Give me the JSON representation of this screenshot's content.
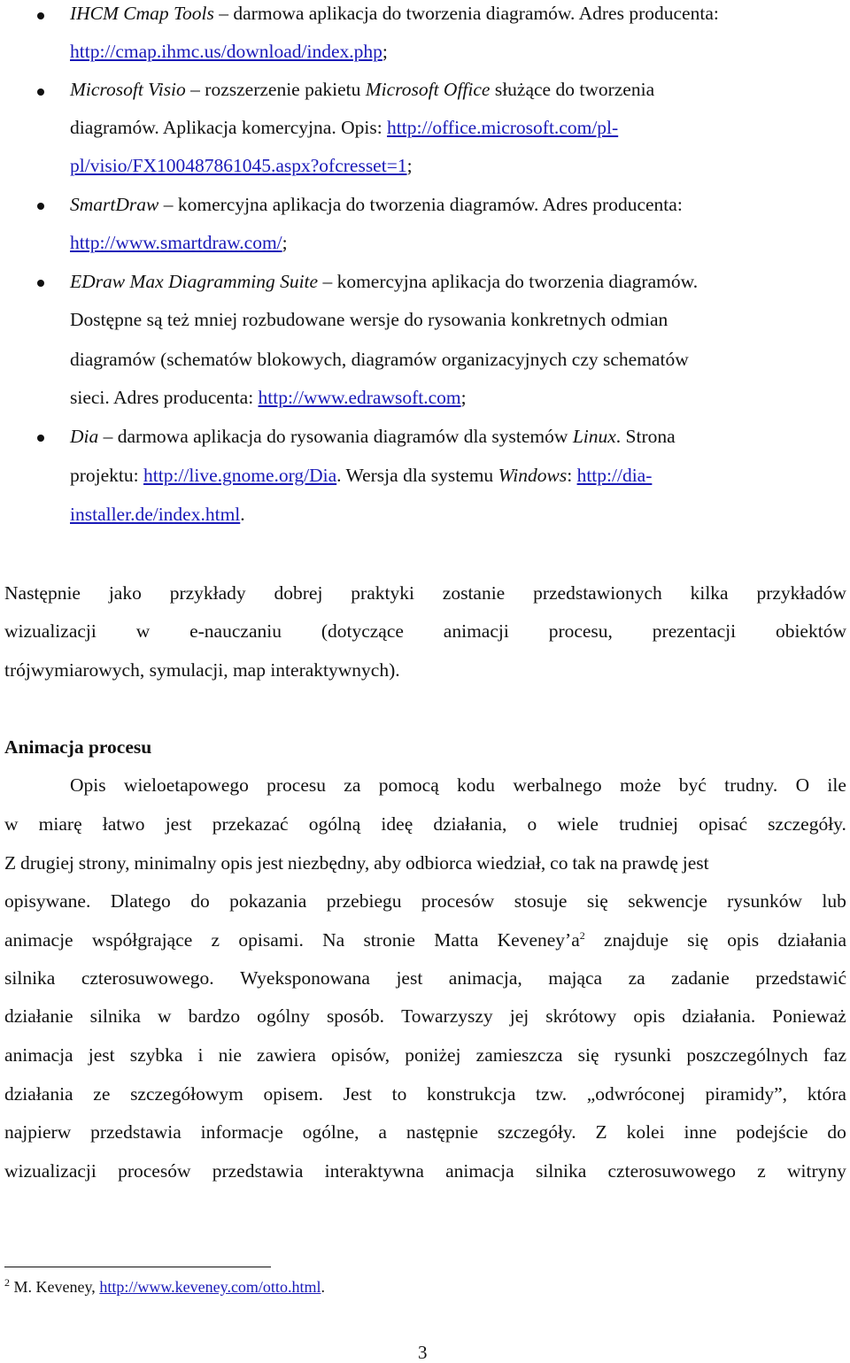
{
  "bullets": [
    {
      "name_italic": "IHCM Cmap Tools",
      "line1_rest": " – darmowa aplikacja do tworzenia diagramów. Adres producenta:",
      "link1": "http://cmap.ihmc.us/download/index.php",
      "line2_after": ";"
    },
    {
      "name_italic": "Microsoft Visio",
      "line1_mid": " – rozszerzenie pakietu ",
      "line1_italic2": "Microsoft Office",
      "line1_rest": " służące do tworzenia",
      "line2_text": "diagramów. Aplikacja komercyjna. Opis: ",
      "link_part1": "http://office.microsoft.com/pl-",
      "link_part2": "pl/visio/FX100487861045.aspx?ofcresset=1",
      "line3_after": ";"
    },
    {
      "name_italic": "SmartDraw",
      "line1_rest": " – komercyjna aplikacja do tworzenia diagramów. Adres producenta:",
      "link1": "http://www.smartdraw.com/",
      "line2_after": ";"
    },
    {
      "name_italic": "EDraw Max Diagramming Suite",
      "line1_rest": " – komercyjna aplikacja do tworzenia diagramów.",
      "line2_text": "Dostępne są też mniej rozbudowane wersje do rysowania konkretnych odmian",
      "line3_text": "diagramów (schematów blokowych, diagramów organizacyjnych czy schematów",
      "line4_text": "sieci. Adres producenta: ",
      "link1": "http://www.edrawsoft.com",
      "line4_after": ";"
    },
    {
      "name_italic": "Dia",
      "line1_mid": " – darmowa aplikacja do rysowania diagramów dla systemów ",
      "line1_italic2": "Linux",
      "line1_rest": ". Strona",
      "line2_text": "projektu: ",
      "link1": "http://live.gnome.org/Dia",
      "line2_mid": ". Wersja dla systemu ",
      "line2_italic": "Windows",
      "line2_mid2": ": ",
      "link2_part1": "http://dia-",
      "link2_part2": "installer.de/index.html",
      "line3_after": "."
    }
  ],
  "intro_paragraph": {
    "line1": "Następnie jako przykłady dobrej praktyki zostanie przedstawionych kilka przykładów",
    "line2": "wizualizacji w e-nauczaniu (dotyczące animacji procesu, prezentacji obiektów",
    "line3": "trójwymiarowych, symulacji, map interaktywnych)."
  },
  "section": {
    "heading": "Animacja procesu",
    "lines": [
      "Opis wieloetapowego procesu za pomocą kodu werbalnego może być trudny. O ile",
      "w miarę łatwo jest przekazać ogólną ideę działania, o wiele trudniej opisać szczegóły.",
      "Z drugiej strony, minimalny opis jest niezbędny, aby odbiorca wiedział, co tak na prawdę jest",
      "opisywane. Dlatego do pokazania przebiegu procesów stosuje się sekwencje rysunków lub",
      "animacje współgrające z opisami. Na stronie Matta Keveney’a",
      "silnika czterosuwowego. Wyeksponowana jest animacja, mająca za zadanie przedstawić",
      "działanie silnika w bardzo ogólny sposób. Towarzyszy jej skrótowy opis działania. Ponieważ",
      "animacja jest szybka i nie zawiera opisów, poniżej zamieszcza się rysunki poszczególnych faz",
      "działania ze szczegółowym opisem. Jest to konstrukcja tzw. „odwróconej piramidy”, która",
      "najpierw przedstawia informacje ogólne, a następnie szczegóły. Z kolei inne podejście do",
      "wizualizacji procesów przedstawia interaktywna animacja silnika czterosuwowego z witryny"
    ],
    "footnote_ref": "2",
    "line5_after_ref": " znajduje się opis działania"
  },
  "footnote": {
    "number": "2",
    "text": " M. Keveney, ",
    "link": "http://www.keveney.com/otto.html",
    "after": "."
  },
  "page_number": "3"
}
